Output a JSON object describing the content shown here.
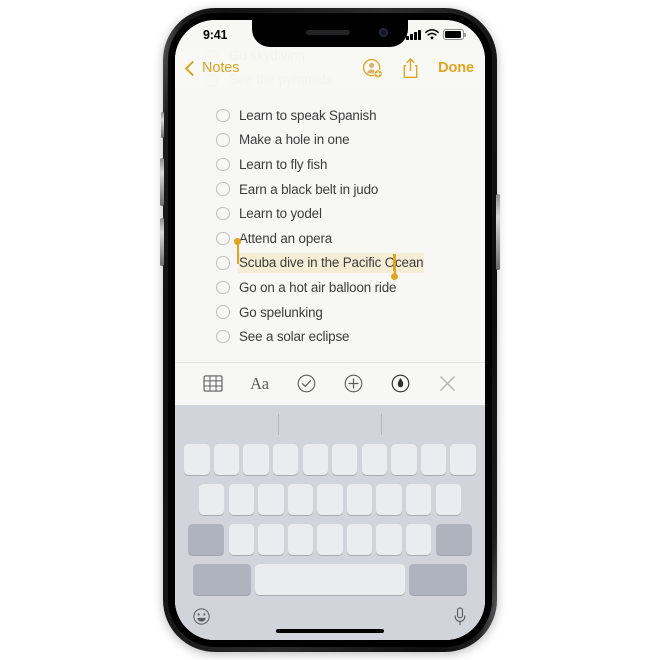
{
  "status_bar": {
    "time": "9:41",
    "cellular_icon": "signal-bars-icon",
    "wifi_icon": "wifi-icon",
    "battery_icon": "battery-icon"
  },
  "nav_bar": {
    "back_label": "Notes",
    "back_icon": "chevron-left-icon",
    "add_person_icon": "add-person-icon",
    "share_icon": "share-icon",
    "done_label": "Done"
  },
  "ghost_lines": [
    {
      "text": "Go skydiving"
    },
    {
      "text": "See the pyramids"
    }
  ],
  "checklist": {
    "items": [
      {
        "text": "Learn to speak Spanish",
        "checked": false,
        "selected": false
      },
      {
        "text": "Make a hole in one",
        "checked": false,
        "selected": false
      },
      {
        "text": "Learn to fly fish",
        "checked": false,
        "selected": false
      },
      {
        "text": "Earn a black belt in judo",
        "checked": false,
        "selected": false
      },
      {
        "text": "Learn to yodel",
        "checked": false,
        "selected": false
      },
      {
        "text": "Attend an opera",
        "checked": false,
        "selected": false
      },
      {
        "text": "Scuba dive in the Pacific Ocean",
        "checked": false,
        "selected": true
      },
      {
        "text": "Go on a hot air balloon ride",
        "checked": false,
        "selected": false
      },
      {
        "text": "Go spelunking",
        "checked": false,
        "selected": false
      },
      {
        "text": "See a solar eclipse",
        "checked": false,
        "selected": false
      }
    ]
  },
  "format_toolbar": {
    "buttons": [
      {
        "name": "table-icon",
        "label": ""
      },
      {
        "name": "text-format-icon",
        "label": "Aa"
      },
      {
        "name": "checklist-icon",
        "label": ""
      },
      {
        "name": "add-attachment-icon",
        "label": ""
      },
      {
        "name": "markup-pen-icon",
        "label": ""
      },
      {
        "name": "close-icon",
        "label": ""
      }
    ]
  },
  "keyboard": {
    "emoji_icon": "emoji-icon",
    "microphone_icon": "microphone-icon",
    "predictive_slots": [
      "",
      "",
      ""
    ],
    "row1_keys": [
      "",
      "",
      "",
      "",
      "",
      "",
      "",
      "",
      "",
      ""
    ],
    "row2_keys": [
      "",
      "",
      "",
      "",
      "",
      "",
      "",
      "",
      ""
    ],
    "row3_keys": [
      "",
      "",
      "",
      "",
      "",
      "",
      ""
    ],
    "shift_key_label": "",
    "delete_key_label": "",
    "number_key_label": "",
    "space_key_label": "",
    "return_key_label": ""
  },
  "colors": {
    "accent_gold": "#d9a326",
    "selection_highlight": "#f5ecd4",
    "note_background": "#f7f7f5",
    "keyboard_background": "#d1d4da",
    "key_light": "#ebecef",
    "key_dark": "#aeb3bd",
    "text_primary": "#3c3c3e"
  }
}
